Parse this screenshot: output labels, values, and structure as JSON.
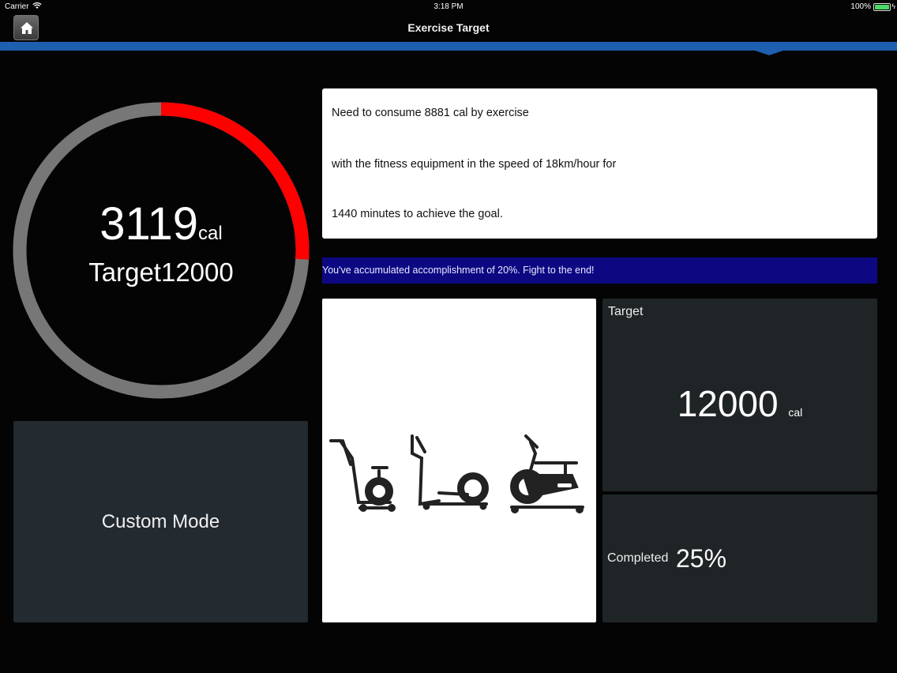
{
  "status_bar": {
    "carrier": "Carrier",
    "time": "3:18 PM",
    "battery": "100%"
  },
  "nav": {
    "title": "Exercise Target",
    "home_icon": "home-icon"
  },
  "ring": {
    "current": "3119",
    "unit": "cal",
    "target_text": "Target12000",
    "progress_fraction": 0.26,
    "progress_color": "#ff0000",
    "track_color": "#777777"
  },
  "mode": {
    "label": "Custom Mode"
  },
  "info": {
    "line1": "Need to consume  8881  cal by exercise",
    "line2": "with the fitness equipment in the speed of 18km/hour for",
    "line3": " 1440 minutes to achieve the goal."
  },
  "banner": {
    "text": "You've accumulated accomplishment of 20%. Fight to the end!"
  },
  "target_card": {
    "label": "Target",
    "value": "12000",
    "unit": "cal"
  },
  "completed_card": {
    "label": "Completed",
    "value": "25%"
  },
  "equipment_icons": [
    "treadmill-icon",
    "elliptical-icon",
    "exercise-bike-icon"
  ]
}
